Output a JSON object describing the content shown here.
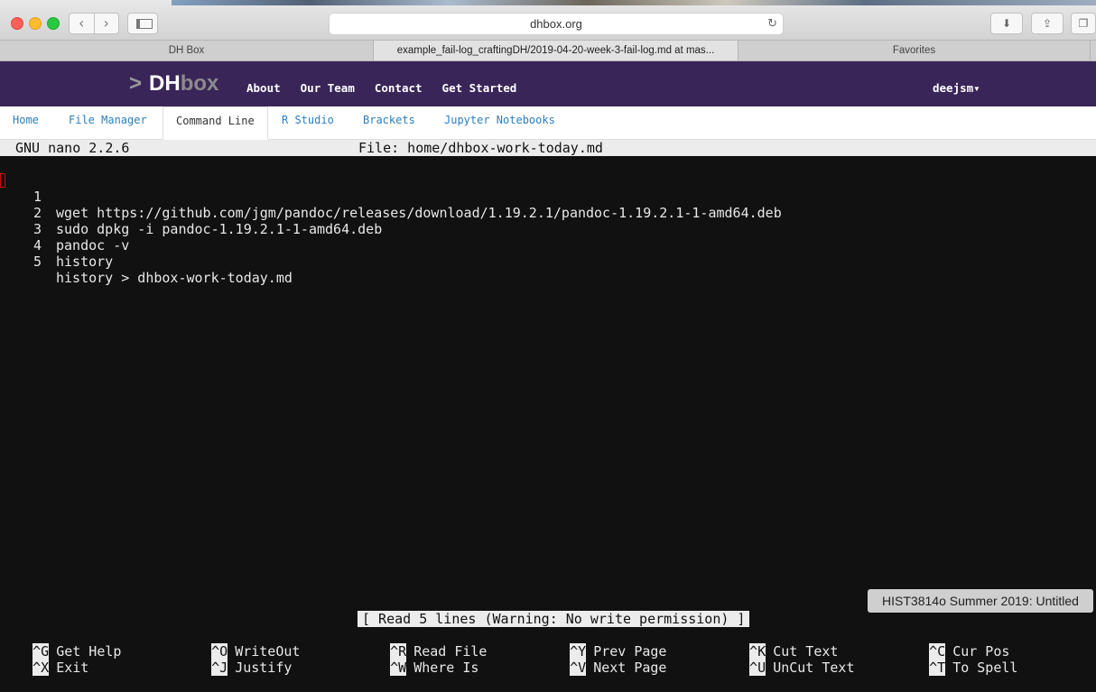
{
  "browser": {
    "url": "dhbox.org",
    "tabs": [
      {
        "label": "DH Box"
      },
      {
        "label": "example_fail-log_craftingDH/2019-04-20-week-3-fail-log.md at mas..."
      },
      {
        "label": "Favorites"
      }
    ]
  },
  "site": {
    "logo_chevron": ">",
    "logo_dh": "DH",
    "logo_box": "box",
    "nav": [
      "About",
      "Our Team",
      "Contact",
      "Get Started"
    ],
    "user": "deejsm▾"
  },
  "apptabs": [
    "Home",
    "File Manager",
    "Command Line",
    "R Studio",
    "Brackets",
    "Jupyter Notebooks"
  ],
  "nano": {
    "version": "GNU nano 2.2.6",
    "file": "File: home/dhbox-work-today.md",
    "lines": [
      {
        "num": "1",
        "text": "wget https://github.com/jgm/pandoc/releases/download/1.19.2.1/pandoc-1.19.2.1-1-amd64.deb"
      },
      {
        "num": "2",
        "text": "sudo dpkg -i pandoc-1.19.2.1-1-amd64.deb"
      },
      {
        "num": "3",
        "text": "pandoc -v"
      },
      {
        "num": "4",
        "text": "history"
      },
      {
        "num": "5",
        "text": "history > dhbox-work-today.md"
      }
    ],
    "status": "[ Read 5 lines (Warning: No write permission) ]",
    "shortcuts": [
      {
        "key": "^G",
        "label": "Get Help"
      },
      {
        "key": "^O",
        "label": "WriteOut"
      },
      {
        "key": "^R",
        "label": "Read File"
      },
      {
        "key": "^Y",
        "label": "Prev Page"
      },
      {
        "key": "^K",
        "label": "Cut Text"
      },
      {
        "key": "^C",
        "label": "Cur Pos"
      },
      {
        "key": "^X",
        "label": "Exit"
      },
      {
        "key": "^J",
        "label": "Justify"
      },
      {
        "key": "^W",
        "label": "Where Is"
      },
      {
        "key": "^V",
        "label": "Next Page"
      },
      {
        "key": "^U",
        "label": "UnCut Text"
      },
      {
        "key": "^T",
        "label": "To Spell"
      }
    ]
  },
  "notification": "HIST3814o Summer 2019: Untitled",
  "colors": {
    "site_header": "#3a2559",
    "link": "#2a7fc1",
    "terminal_bg": "#111111"
  }
}
